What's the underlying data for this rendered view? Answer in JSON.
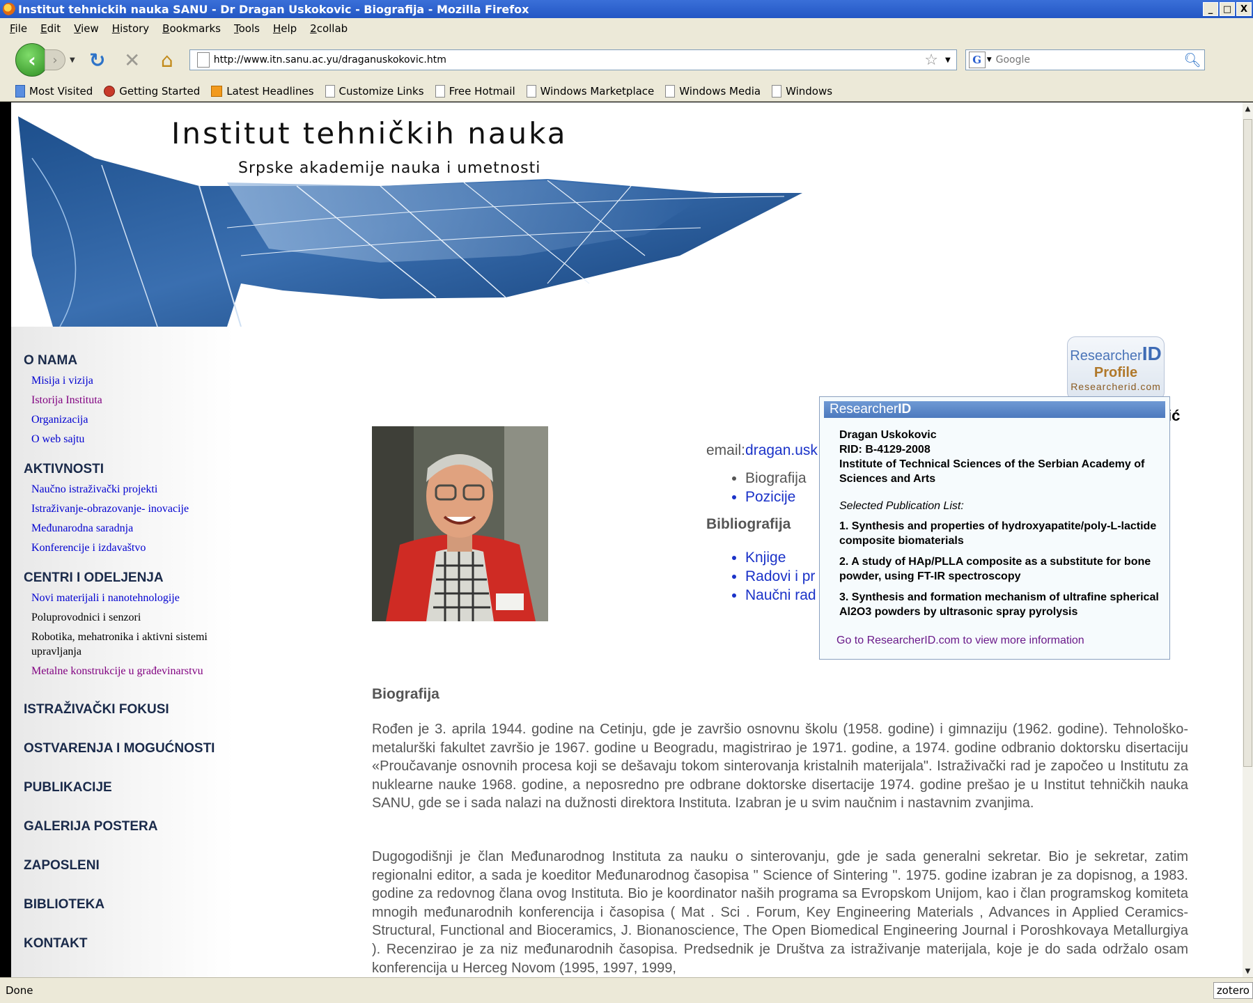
{
  "window": {
    "title": "Institut tehnickih nauka SANU - Dr Dragan Uskokovic - Biografija - Mozilla Firefox",
    "buttons": [
      "_",
      "□",
      "X"
    ]
  },
  "menu": [
    "File",
    "Edit",
    "View",
    "History",
    "Bookmarks",
    "Tools",
    "Help",
    "2collab"
  ],
  "nav": {
    "url": "http://www.itn.sanu.ac.yu/draganuskokovic.htm",
    "search_placeholder": "Google"
  },
  "bookmarks": [
    "Most Visited",
    "Getting Started",
    "Latest Headlines",
    "Customize Links",
    "Free Hotmail",
    "Windows Marketplace",
    "Windows Media",
    "Windows"
  ],
  "banner": {
    "title": "Institut tehničkih nauka",
    "subtitle": "Srpske akademije nauka i umetnosti"
  },
  "leftnav": {
    "o_nama": "O NAMA",
    "o_nama_links": [
      "Misija i vizija",
      "Istorija Instituta",
      "Organizacija",
      "O web sajtu"
    ],
    "aktivnosti": "AKTIVNOSTI",
    "aktivnosti_links": [
      "Naučno istraživački projekti",
      "Istraživanje-obrazovanje- inovacije",
      "Međunarodna saradnja",
      "Konferencije i izdavaštvo"
    ],
    "centri": "CENTRI I ODELJENJA",
    "centri_links": [
      "Novi materijali i nanotehnologije",
      "Poluprovodnici i senzori",
      "Robotika, mehatronika i aktivni sistemi upravljanja",
      "Metalne konstrukcije u građevinarstvu"
    ],
    "sections": [
      "ISTRAŽIVAČKI FOKUSI",
      "OSTVARENJA I MOGUĆNOSTI",
      "PUBLIKACIJE",
      "GALERIJA POSTERA",
      "ZAPOSLENI",
      "BIBLIOTEKA",
      "KONTAKT"
    ]
  },
  "rid_badge": {
    "line1": "Researcher",
    "line1_bold": "ID",
    "line2": "Profile",
    "line3": "Researcherid.com"
  },
  "contact": {
    "email_label": "email:",
    "email": "dragan.usk",
    "links": [
      "Biografija",
      "Pozicije"
    ],
    "bib_heading": "Bibliografija",
    "bib_links": [
      "Knjige",
      "Radovi i pr",
      "Naučni rad"
    ],
    "name_cut": "ić"
  },
  "popup": {
    "head": "Researcher",
    "head_bold": "ID",
    "name": "Dragan Uskokovic",
    "rid": "RID: B-4129-2008",
    "institution": "Institute of Technical Sciences of the Serbian Academy of Sciences and Arts",
    "selected_label": "Selected Publication List:",
    "publications": [
      "1. Synthesis and properties of hydroxyapatite/poly-L-lactide composite biomaterials",
      "2. A study of HAp/PLLA composite as a substitute for bone powder, using FT-IR spectroscopy",
      "3. Synthesis and formation mechanism of ultrafine spherical Al2O3 powders by ultrasonic spray pyrolysis"
    ],
    "more": "Go to ResearcherID.com to view more information"
  },
  "bio": {
    "heading": "Biografija",
    "p1": "Rođen je 3. aprila 1944. godine na Cetinju, gde je završio osnovnu školu (1958. godine) i gimnaziju (1962. godine). Tehnološko-metalurški fakultet završio je 1967. godine u Beogradu, magistrirao je 1971. godine, a 1974. godine odbranio doktorsku disertaciju «Proučavanje osnovnih procesa koji se dešavaju tokom sinterovanja kristalnih materijala\". Istraživački rad je započeo u Institutu za nuklearne nauke 1968. godine, a neposredno pre odbrane doktorske disertacije 1974. godine prešao je u Institut tehničkih nauka SANU, gde se i sada nalazi na dužnosti direktora Instituta. Izabran je u svim naučnim i nastavnim zvanjima.",
    "p2": "Dugogodišnji je član Međunarodnog Instituta za nauku o sinterovanju, gde je sada generalni sekretar. Bio je sekretar, zatim regionalni editor, a sada je koeditor Međunarodnog časopisa \" Science of Sintering \". 1975. godine izabran je za dopisnog, a 1983. godine za redovnog člana ovog Instituta. Bio je koordinator naših programa sa Evropskom Unijom, kao i član programskog komiteta mnogih međunarodnih konferencija i časopisa ( Mat . Sci . Forum, Key Engineering Materials , Advances in Applied Ceramics-Structural, Functional and Bioceramics, J. Bionanoscience, The Open Biomedical Engineering Journal i Poroshkovaya Metallurgiya ). Recenzirao je za niz međunarodnih časopisa. Predsednik je Društva za istraživanje materijala, koje je do sada održalo osam konferencija u Herceg Novom (1995, 1997, 1999,"
  },
  "status": {
    "text": "Done",
    "zotero": "zotero"
  }
}
